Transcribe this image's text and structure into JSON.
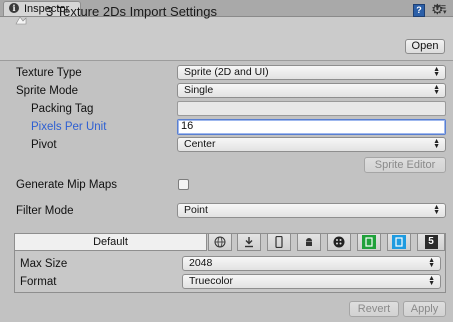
{
  "tab": {
    "label": "Inspector",
    "menu": "▾≡"
  },
  "header": {
    "title": "3 Texture 2Ds Import Settings",
    "open_label": "Open",
    "book_glyph": "?",
    "gear_glyph": "⚙"
  },
  "rows": {
    "texture_type": {
      "label": "Texture Type",
      "value": "Sprite (2D and UI)"
    },
    "sprite_mode": {
      "label": "Sprite Mode",
      "value": "Single"
    },
    "packing_tag": {
      "label": "Packing Tag",
      "value": ""
    },
    "pixels_per_unit": {
      "label": "Pixels Per Unit",
      "value": "16"
    },
    "pivot": {
      "label": "Pivot",
      "value": "Center"
    },
    "sprite_editor": {
      "label": "Sprite Editor"
    },
    "generate_mip_maps": {
      "label": "Generate Mip Maps",
      "checked": false
    },
    "filter_mode": {
      "label": "Filter Mode",
      "value": "Point"
    }
  },
  "platform": {
    "default_tab": "Default",
    "tabs": [
      {
        "name": "web-globe",
        "glyph": "◎"
      },
      {
        "name": "standalone-download",
        "glyph": "⬇"
      },
      {
        "name": "ios-phone",
        "glyph": "▯"
      },
      {
        "name": "android",
        "glyph": "♦"
      },
      {
        "name": "blackberry",
        "glyph": "⁙"
      },
      {
        "name": "windows-store-green",
        "glyph": "▣"
      },
      {
        "name": "windows-phone-blue",
        "glyph": "▣"
      },
      {
        "name": "html5",
        "glyph": "5"
      }
    ],
    "max_size": {
      "label": "Max Size",
      "value": "2048"
    },
    "format": {
      "label": "Format",
      "value": "Truecolor"
    }
  },
  "footer": {
    "revert_label": "Revert",
    "apply_label": "Apply"
  },
  "colors": {
    "field_label_active": "#2d5fd2",
    "windows_store": "#1fa13a",
    "windows_phone": "#1e9be0",
    "html5_bg": "#2b2b2b"
  }
}
